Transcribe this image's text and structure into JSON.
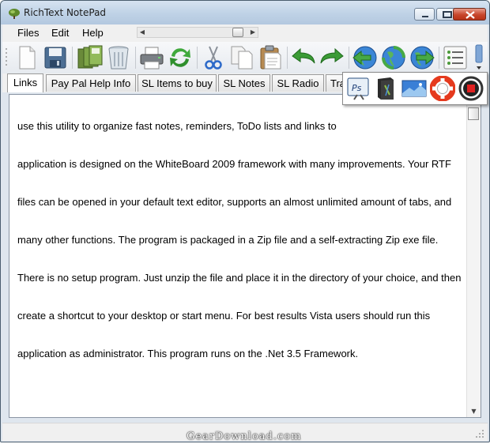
{
  "window": {
    "title": "RichText NotePad"
  },
  "menu": {
    "items": [
      "Files",
      "Edit",
      "Help"
    ]
  },
  "toolbar": {
    "icons": [
      "new-document-icon",
      "save-icon",
      "save-all-icon",
      "recycle-bin-icon",
      "printer-icon",
      "refresh-icon",
      "cut-icon",
      "copy-icon",
      "paste-icon",
      "undo-icon",
      "redo-icon",
      "globe-back-icon",
      "globe-home-icon",
      "globe-forward-icon",
      "list-icon"
    ]
  },
  "tabs": [
    "Links",
    "Pay Pal Help Info",
    "SL Items to buy",
    "SL Notes",
    "SL Radio",
    "Tra"
  ],
  "popup": {
    "icons": [
      "photoshop-icon",
      "book-icon",
      "image-icon",
      "lifebuoy-icon",
      "stop-icon"
    ]
  },
  "editor": {
    "lines": [
      "use this utility to organize fast notes, reminders, ToDo lists and links to",
      "application is designed on the WhiteBoard 2009 framework with many improvements. Your RTF",
      "files can be opened in your default text editor, supports an almost unlimited amount of tabs, and",
      "many other functions. The program is packaged in a Zip file and a self-extracting Zip exe file.",
      "There is no setup program. Just unzip the file and place it in the directory of your choice, and then",
      "create a shortcut to your desktop or start menu. For best results Vista users should run this",
      "application as administrator. This program runs on the .Net 3.5 Framework."
    ]
  },
  "watermark": "GearDownload.com",
  "colors": {
    "titlebar": "#c6d7ea",
    "close_button": "#c7462b",
    "text": "#000000"
  }
}
